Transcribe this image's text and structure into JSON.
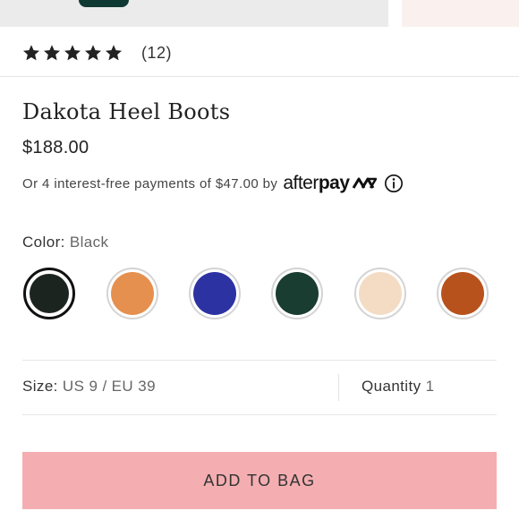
{
  "rating": {
    "stars": 5,
    "review_count": "(12)"
  },
  "product": {
    "title": "Dakota Heel Boots",
    "price": "$188.00"
  },
  "afterpay": {
    "text": "Or 4 interest-free payments of $47.00 by",
    "logo_light": "after",
    "logo_bold": "pay"
  },
  "color": {
    "label": "Color:",
    "selected": "Black",
    "swatches": [
      {
        "hex": "#1c2420",
        "selected": true
      },
      {
        "hex": "#e6904f",
        "selected": false
      },
      {
        "hex": "#2d32a3",
        "selected": false
      },
      {
        "hex": "#193d30",
        "selected": false
      },
      {
        "hex": "#f4dcc4",
        "selected": false
      },
      {
        "hex": "#b8521c",
        "selected": false
      }
    ]
  },
  "size": {
    "label": "Size:",
    "value": "US 9 / EU 39"
  },
  "quantity": {
    "label": "Quantity",
    "value": "1"
  },
  "cta": {
    "add_label": "ADD TO BAG"
  },
  "colors": {
    "cta_bg": "#f4aeb1",
    "divider": "#e6e6e6"
  }
}
